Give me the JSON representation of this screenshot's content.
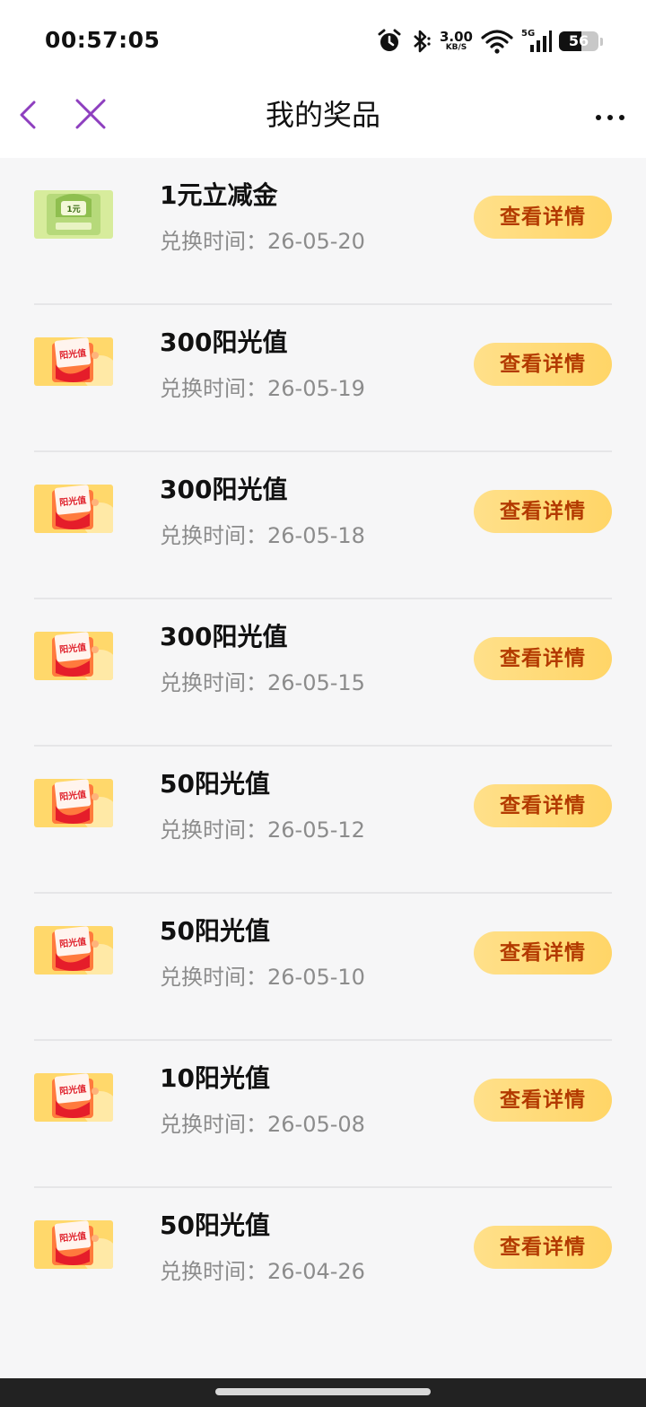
{
  "status": {
    "time": "00:57:05",
    "net_speed_value": "3.00",
    "net_speed_unit": "KB/S",
    "network_label": "5G",
    "battery_level": "56"
  },
  "nav": {
    "title": "我的奖品"
  },
  "prizes": [
    {
      "title": "1元立减金",
      "date": "兑换时间：26-05-20",
      "button": "查看详情",
      "thumb": "cash-coupon",
      "thumb_text": "1元"
    },
    {
      "title": "300阳光值",
      "date": "兑换时间：26-05-19",
      "button": "查看详情",
      "thumb": "sunshine",
      "thumb_text": "阳光值"
    },
    {
      "title": "300阳光值",
      "date": "兑换时间：26-05-18",
      "button": "查看详情",
      "thumb": "sunshine",
      "thumb_text": "阳光值"
    },
    {
      "title": "300阳光值",
      "date": "兑换时间：26-05-15",
      "button": "查看详情",
      "thumb": "sunshine",
      "thumb_text": "阳光值"
    },
    {
      "title": "50阳光值",
      "date": "兑换时间：26-05-12",
      "button": "查看详情",
      "thumb": "sunshine",
      "thumb_text": "阳光值"
    },
    {
      "title": "50阳光值",
      "date": "兑换时间：26-05-10",
      "button": "查看详情",
      "thumb": "sunshine",
      "thumb_text": "阳光值"
    },
    {
      "title": "10阳光值",
      "date": "兑换时间：26-05-08",
      "button": "查看详情",
      "thumb": "sunshine",
      "thumb_text": "阳光值"
    },
    {
      "title": "50阳光值",
      "date": "兑换时间：26-04-26",
      "button": "查看详情",
      "thumb": "sunshine",
      "thumb_text": "阳光值"
    }
  ],
  "colors": {
    "accent_purple": "#8e3fbf",
    "button_gradient_start": "#ffe08a",
    "button_gradient_end": "#ffd567",
    "button_text": "#b33a00"
  }
}
